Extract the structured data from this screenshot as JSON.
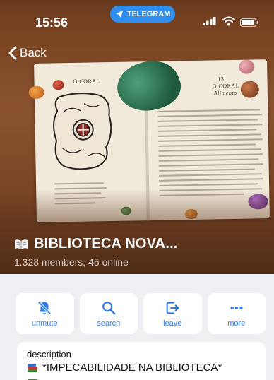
{
  "status_bar": {
    "time": "15:56",
    "source_app": "TELEGRAM",
    "signal_icon": "signal-bars-icon",
    "wifi_icon": "wifi-icon",
    "battery_icon": "battery-icon"
  },
  "nav": {
    "back_label": "Back"
  },
  "group": {
    "title": "BIBLIOTECA NOVA...",
    "title_icon": "open-book-icon",
    "subtitle": "1.328 members, 45 online"
  },
  "actions": [
    {
      "label": "unmute",
      "icon": "bell-slash-icon"
    },
    {
      "label": "search",
      "icon": "search-icon"
    },
    {
      "label": "leave",
      "icon": "leave-icon"
    },
    {
      "label": "more",
      "icon": "more-icon"
    }
  ],
  "description": {
    "label": "description",
    "first_line": "*IMPECABILIDADE NA BIBLIOTECA*",
    "line_icon": "books-emoji-icon"
  },
  "photo": {
    "left_page_heading": "O CORAL",
    "right_page_number": "13",
    "right_page_heading": "O CORAL",
    "right_page_sub": "Alimento"
  },
  "colors": {
    "accent": "#2f7be6",
    "telegram_pill": "#2f8ff0",
    "hero_brown": "#7a4422",
    "background": "#efeff4"
  }
}
